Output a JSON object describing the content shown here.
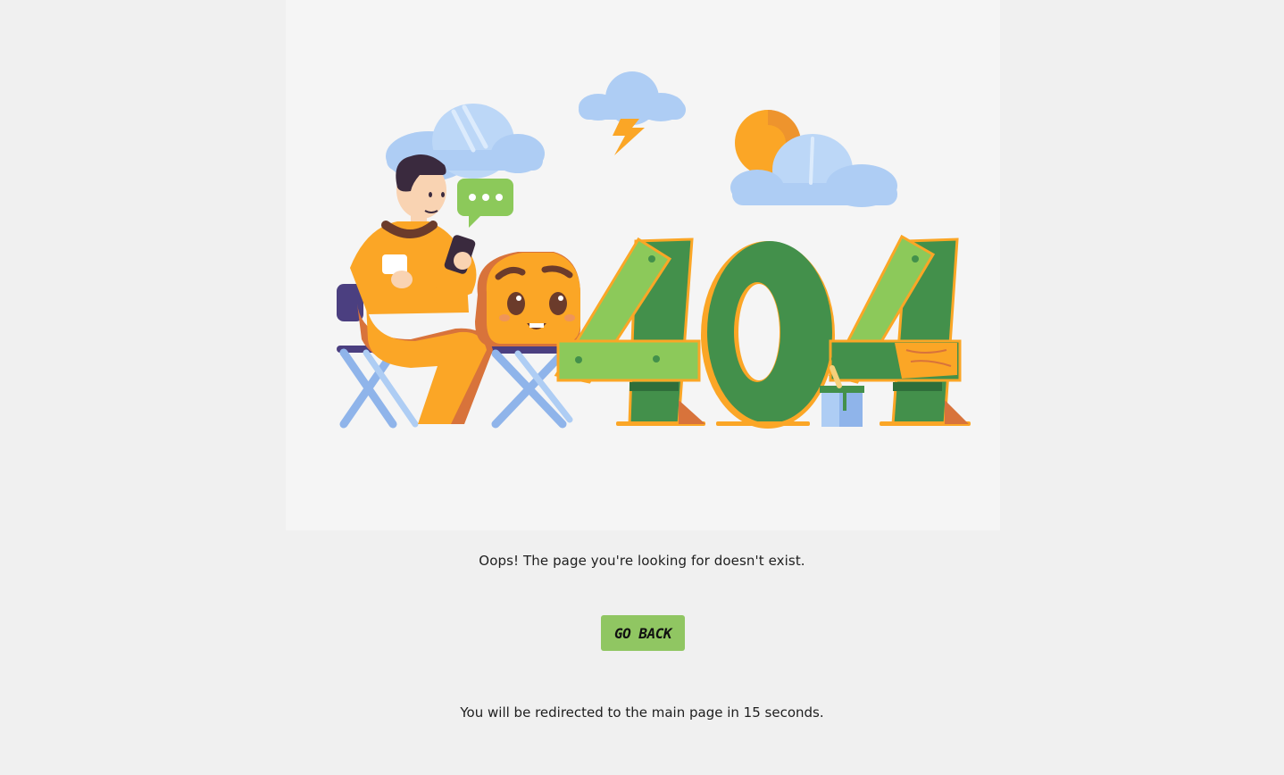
{
  "illustration": {
    "error_code_digits": [
      "4",
      "0",
      "4"
    ],
    "colors": {
      "panel_bg": "#f5f5f5",
      "green_dark": "#43904b",
      "green_light": "#8cc95a",
      "orange": "#fba626",
      "orange_dark": "#d8733b",
      "cloud": "#aecdf4",
      "chair_blue": "#8fb4ea",
      "chair_seat": "#4b3f80",
      "hair": "#3a2a3e",
      "skin": "#f9d3b2"
    }
  },
  "message": {
    "text": "Oops! The page you're looking for doesn't exist."
  },
  "actions": {
    "go_back_label": "GO BACK",
    "go_back_color": "#90c662"
  },
  "redirect": {
    "text": "You will be redirected to the main page in 15 seconds."
  }
}
